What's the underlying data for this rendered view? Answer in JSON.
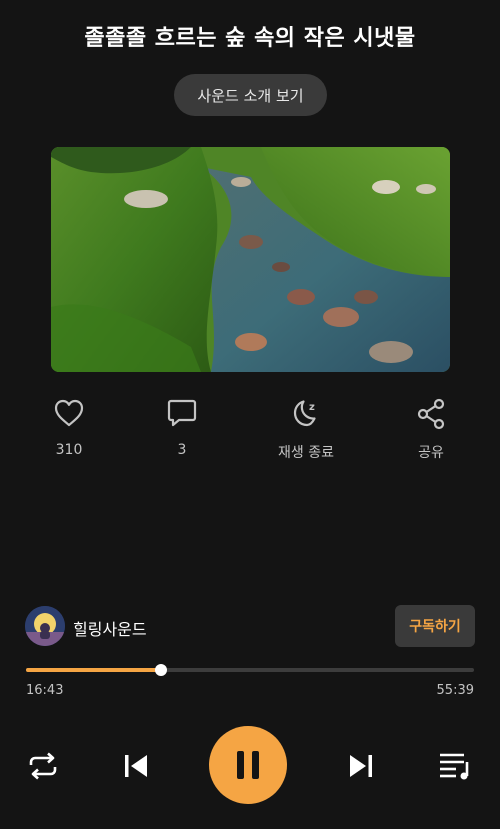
{
  "title": "졸졸졸 흐르는 숲 속의 작은 시냇물",
  "intro_button": "사운드 소개 보기",
  "cover": {
    "alt_icon": "stream-landscape-image"
  },
  "actions": {
    "like_count": "310",
    "comment_count": "3",
    "sleep_label": "재생 종료",
    "share_label": "공유"
  },
  "channel": {
    "name": "힐링사운드",
    "subscribe_label": "구독하기"
  },
  "player": {
    "current_time": "16:43",
    "total_time": "55:39",
    "progress": 0.302
  },
  "colors": {
    "accent": "#f5a544",
    "background": "#141414",
    "pill": "#3a3a3a"
  },
  "icons": [
    "heart-icon",
    "comment-icon",
    "moon-sleep-icon",
    "share-icon",
    "repeat-icon",
    "previous-icon",
    "pause-icon",
    "next-icon",
    "playlist-icon"
  ]
}
